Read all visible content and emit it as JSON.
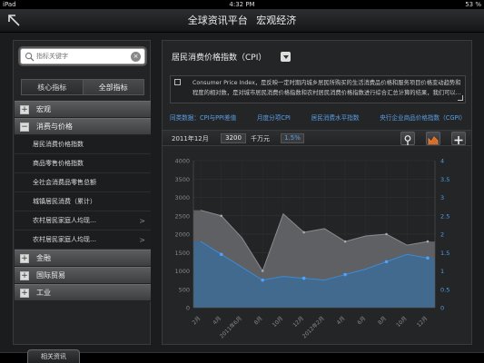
{
  "status": {
    "device": "iPad",
    "time": "4:32 PM",
    "battery": "53 %"
  },
  "header": {
    "title": "全球资讯平台",
    "subtitle": "宏观经济"
  },
  "sidebar": {
    "search_placeholder": "指标关键字",
    "tabs": [
      {
        "label": "核心指标"
      },
      {
        "label": "全部指标"
      }
    ],
    "tree": [
      {
        "type": "group",
        "mark": "+",
        "label": "宏观"
      },
      {
        "type": "group",
        "mark": "−",
        "label": "消费与价格"
      },
      {
        "type": "leaf",
        "label": "居民消费价格指数",
        "arrow": ""
      },
      {
        "type": "leaf",
        "label": "商品零售价格指数",
        "arrow": ""
      },
      {
        "type": "leaf",
        "label": "全社会消费品零售总额",
        "arrow": ""
      },
      {
        "type": "leaf",
        "label": "城镇居民消费（累计）",
        "arrow": ""
      },
      {
        "type": "leaf",
        "label": "农村居民家庭人均现…",
        "arrow": ">"
      },
      {
        "type": "leaf",
        "label": "农村居民家庭人均现…",
        "arrow": ">"
      },
      {
        "type": "group",
        "mark": "+",
        "label": "金融"
      },
      {
        "type": "group",
        "mark": "+",
        "label": "国际贸易"
      },
      {
        "type": "group",
        "mark": "+",
        "label": "工业"
      }
    ]
  },
  "main": {
    "title": "居民消费价格指数（CPI）",
    "description": "Consumer Price Index，是反映一定时期内城乡居民所购买的生活消费品价格和服务项目价格变动趋势和程度的相对数，是对城市居民消费价格指数和农村居民消费价格指数进行综合汇总计算的结果，我们可以…",
    "links": [
      "同类数据：CPI与PPI差值",
      "月度分项CPI",
      "居民消费水平指数",
      "央行企业商品价格指数（CGPI）"
    ],
    "toolbar": {
      "date": "2011年12月",
      "value": "3200",
      "unit": "千万元",
      "percent": "1.5%"
    },
    "icons": {
      "pin": "location-pin-icon",
      "chart": "chart-type-icon",
      "add": "plus-icon"
    }
  },
  "chart_data": {
    "type": "area",
    "categories": [
      "2月",
      "4月",
      "2011年6月",
      "8月",
      "10月",
      "12月",
      "2012年2月",
      "4月",
      "6月",
      "8月",
      "10月",
      "12月"
    ],
    "y_left_ticks": [
      0,
      500,
      1000,
      1500,
      2000,
      2500,
      3000,
      3500,
      4000
    ],
    "y_right_ticks": [
      0,
      0.5,
      1,
      1.5,
      2,
      2.5,
      3,
      3.5,
      4
    ],
    "ylim_left": [
      0,
      4000
    ],
    "ylim_right": [
      0,
      4
    ],
    "series": [
      {
        "axis": "left",
        "color": "#6a6b6e",
        "values": [
          2650,
          2500,
          1900,
          1000,
          2550,
          2050,
          2150,
          1800,
          1950,
          2000,
          1700,
          1800
        ]
      },
      {
        "axis": "right",
        "color": "#2e6fab",
        "values": [
          1.8,
          1.45,
          1.1,
          0.75,
          0.85,
          0.8,
          0.75,
          0.9,
          1.05,
          1.25,
          1.45,
          1.35
        ]
      }
    ],
    "grid": true,
    "colors": {
      "left_axis": "#888888",
      "right_axis": "#4f9ee8"
    }
  },
  "footer": {
    "tab": "相关资讯"
  }
}
